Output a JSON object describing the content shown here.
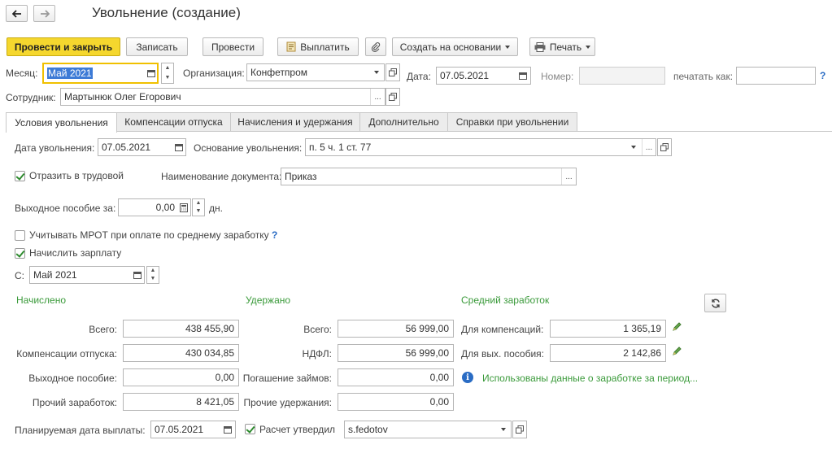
{
  "nav": {
    "back_icon": "arrow-left-icon",
    "forward_icon": "arrow-right-icon"
  },
  "window": {
    "title": "Увольнение (создание)"
  },
  "toolbar": {
    "post_close": "Провести и закрыть",
    "save": "Записать",
    "post": "Провести",
    "pay": "Выплатить",
    "create_based": "Создать на основании",
    "print": "Печать"
  },
  "header": {
    "month_label": "Месяц:",
    "month_value": "Май 2021",
    "org_label": "Организация:",
    "org_value": "Конфетпром",
    "date_label": "Дата:",
    "date_value": "07.05.2021",
    "number_label": "Номер:",
    "number_value": "",
    "print_as_label": "печатать как:",
    "print_as_value": "",
    "help": "?",
    "employee_label": "Сотрудник:",
    "employee_value": "Мартынюк Олег Егорович"
  },
  "tabs": [
    {
      "label": "Условия увольнения",
      "active": true
    },
    {
      "label": "Компенсации отпуска"
    },
    {
      "label": "Начисления и удержания"
    },
    {
      "label": "Дополнительно"
    },
    {
      "label": "Справки при увольнении"
    }
  ],
  "form": {
    "dismissal_date_label": "Дата увольнения:",
    "dismissal_date": "07.05.2021",
    "basis_label": "Основание увольнения:",
    "basis_value": "п. 5 ч. 1 ст. 77",
    "reflect_label": "Отразить в трудовой",
    "reflect_checked": true,
    "doc_name_label": "Наименование документа:",
    "doc_name_value": "Приказ",
    "severance_label": "Выходное пособие за:",
    "severance_value": "0,00",
    "severance_unit": "дн.",
    "mrot_label": "Учитывать МРОТ при оплате по среднему заработку",
    "mrot_checked": false,
    "mrot_help": "?",
    "salary_label": "Начислить зарплату",
    "salary_checked": true,
    "from_label": "С:",
    "from_value": "Май 2021",
    "ellipsis": "..."
  },
  "accrued": {
    "title": "Начислено",
    "rows": [
      {
        "label": "Всего:",
        "value": "438 455,90"
      },
      {
        "label": "Компенсации отпуска:",
        "value": "430 034,85"
      },
      {
        "label": "Выходное пособие:",
        "value": "0,00"
      },
      {
        "label": "Прочий заработок:",
        "value": "8 421,05"
      }
    ]
  },
  "withheld": {
    "title": "Удержано",
    "rows": [
      {
        "label": "Всего:",
        "value": "56 999,00"
      },
      {
        "label": "НДФЛ:",
        "value": "56 999,00"
      },
      {
        "label": "Погашение займов:",
        "value": "0,00"
      },
      {
        "label": "Прочие удержания:",
        "value": "0,00"
      }
    ]
  },
  "average": {
    "title": "Средний заработок",
    "rows": [
      {
        "label": "Для компенсаций:",
        "value": "1 365,19"
      },
      {
        "label": "Для вых. пособия:",
        "value": "2 142,86"
      }
    ],
    "info": "Использованы данные о заработке за период..."
  },
  "footer": {
    "pay_date_label": "Планируемая дата выплаты:",
    "pay_date": "07.05.2021",
    "approved_label": "Расчет утвердил",
    "approved_checked": true,
    "approved_value": "s.fedotov"
  },
  "colors": {
    "primary": "#f5d72e",
    "green_heading": "#3a9a3a",
    "focus": "#f0c000",
    "selection": "#3d7bd6"
  }
}
